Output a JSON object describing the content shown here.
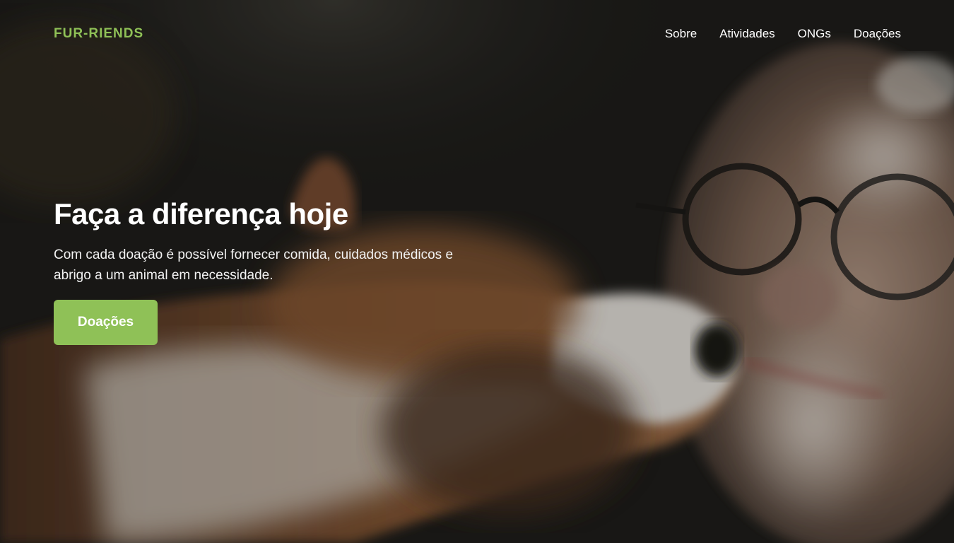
{
  "nav": {
    "brand": "FUR-RIENDS",
    "links": [
      {
        "label": "Sobre"
      },
      {
        "label": "Atividades"
      },
      {
        "label": "ONGs"
      },
      {
        "label": "Doações"
      }
    ]
  },
  "hero": {
    "title": "Faça a diferença hoje",
    "subtitle": "Com cada doação é possível fornecer comida, cuidados médicos e abrigo a um animal em necessidade.",
    "cta_label": "Doações",
    "background_image": "dog-licking-smiling-woman-with-glasses"
  },
  "colors": {
    "accent": "#8fc157",
    "text": "#ffffff",
    "overlay": "#1a1a18"
  }
}
